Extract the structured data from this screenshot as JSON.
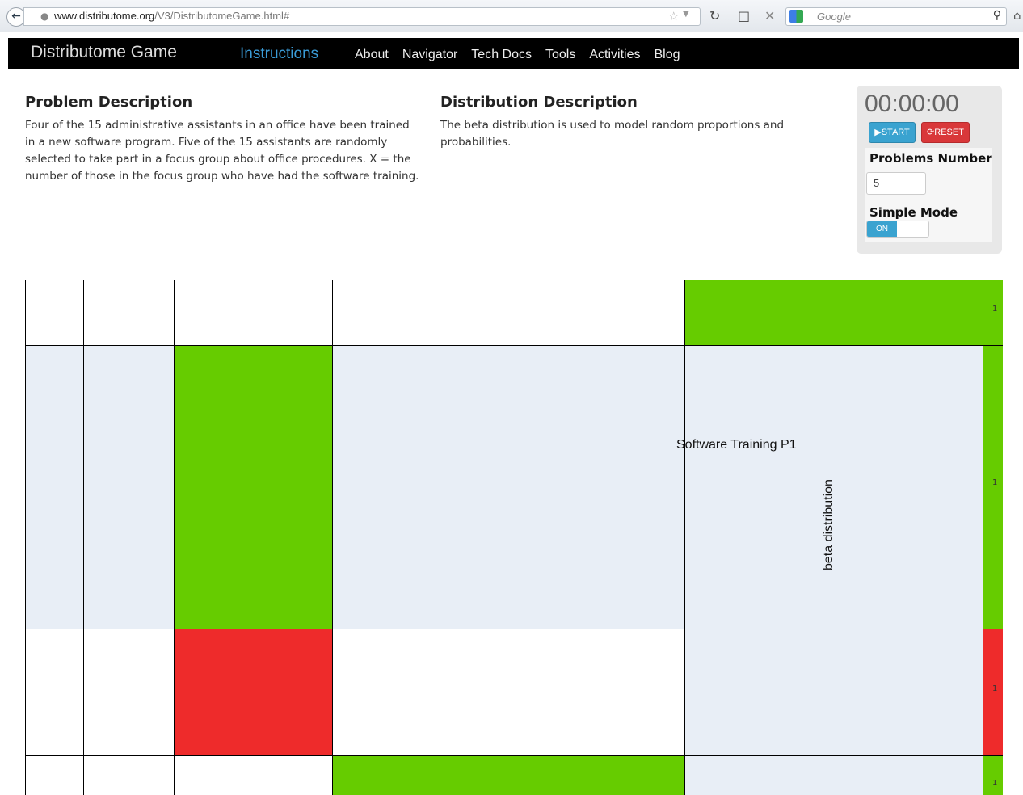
{
  "browser": {
    "url_domain": "www.distributome.org",
    "url_path": "/V3/DistributomeGame.html#",
    "search_placeholder": "Google"
  },
  "navbar": {
    "brand": "Distributome Game",
    "active": "Instructions",
    "links": [
      "About",
      "Navigator",
      "Tech Docs",
      "Tools",
      "Activities",
      "Blog"
    ]
  },
  "problem": {
    "title": "Problem Description",
    "text": "Four of the 15 administrative assistants in an office have been trained in a new software program. Five of the 15 assistants are randomly selected to take part in a focus group about office procedures. X = the number of those in the focus group who have had the software training."
  },
  "distribution": {
    "title": "Distribution Description",
    "text": "The beta distribution is used to model random proportions and probabilities."
  },
  "panel": {
    "timer": "00:00:00",
    "start_label": "START",
    "reset_label": "RESET",
    "problems_label": "Problems Number",
    "problems_value": "5",
    "simple_mode_label": "Simple Mode",
    "toggle_label": "ON"
  },
  "grid": {
    "node_label": "Software Training P1",
    "distribution_label": "beta distribution",
    "side_numbers": [
      "1",
      "1",
      "1",
      "1"
    ]
  },
  "colors": {
    "green": "#66cc00",
    "red": "#ee2b2b",
    "light": "#e8eef6",
    "navbar": "#000000",
    "accent": "#3a9bd6"
  }
}
